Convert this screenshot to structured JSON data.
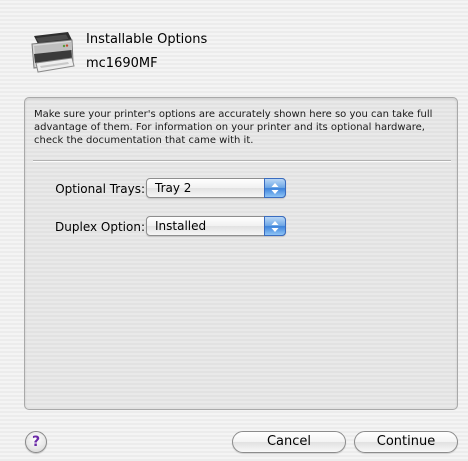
{
  "header": {
    "title": "Installable Options",
    "printer_model": "mc1690MF",
    "icon": "printer-icon"
  },
  "panel": {
    "description": "Make sure your printer's options are accurately shown here so you can take full advantage of them.  For information on your printer and its optional hardware, check the documentation that came with it.",
    "options": [
      {
        "label": "Optional Trays:",
        "value": "Tray 2"
      },
      {
        "label": "Duplex Option:",
        "value": "Installed"
      }
    ]
  },
  "buttons": {
    "help": "?",
    "cancel": "Cancel",
    "continue": "Continue"
  },
  "colors": {
    "popup_arrow_accent": "#3d83db",
    "help_glyph": "#6b2aa8"
  }
}
